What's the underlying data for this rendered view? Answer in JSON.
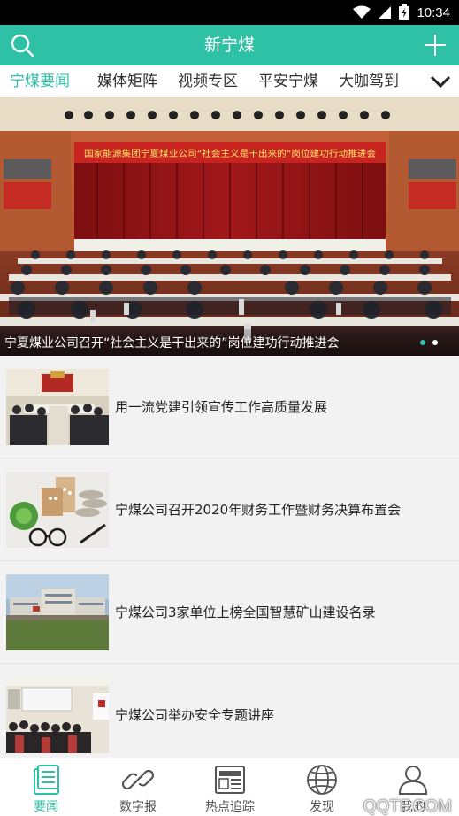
{
  "status_bar": {
    "time": "10:34"
  },
  "header": {
    "title": "新宁煤",
    "search_icon": "search-icon",
    "add_icon": "plus-icon"
  },
  "tabs": [
    {
      "label": "宁煤要闻",
      "active": true
    },
    {
      "label": "媒体矩阵",
      "active": false
    },
    {
      "label": "视频专区",
      "active": false
    },
    {
      "label": "平安宁煤",
      "active": false
    },
    {
      "label": "大咖驾到",
      "active": false
    }
  ],
  "banner": {
    "sign_text": "国家能源集团宁夏煤业公司“社会主义是干出来的”岗位建功行动推进会",
    "caption": "宁夏煤业公司召开“社会主义是干出来的”岗位建功行动推进会",
    "slides": 2,
    "active_slide": 1
  },
  "news": [
    {
      "title": "用一流党建引领宣传工作高质量发展"
    },
    {
      "title": "宁煤公司召开2020年财务工作暨财务决算布置会"
    },
    {
      "title": "宁煤公司3家单位上榜全国智慧矿山建设名录"
    },
    {
      "title": "宁煤公司举办安全专题讲座"
    }
  ],
  "bottom_nav": [
    {
      "label": "要闻",
      "icon": "news-icon",
      "active": true
    },
    {
      "label": "数字报",
      "icon": "link-icon",
      "active": false
    },
    {
      "label": "热点追踪",
      "icon": "newspaper-icon",
      "active": false
    },
    {
      "label": "发现",
      "icon": "globe-icon",
      "active": false
    },
    {
      "label": "我的",
      "icon": "person-icon",
      "active": false
    }
  ],
  "watermark": "QQTF.COM",
  "colors": {
    "accent": "#2fc1a6",
    "status_bar": "#000000",
    "list_bg": "#f2f2f2"
  }
}
